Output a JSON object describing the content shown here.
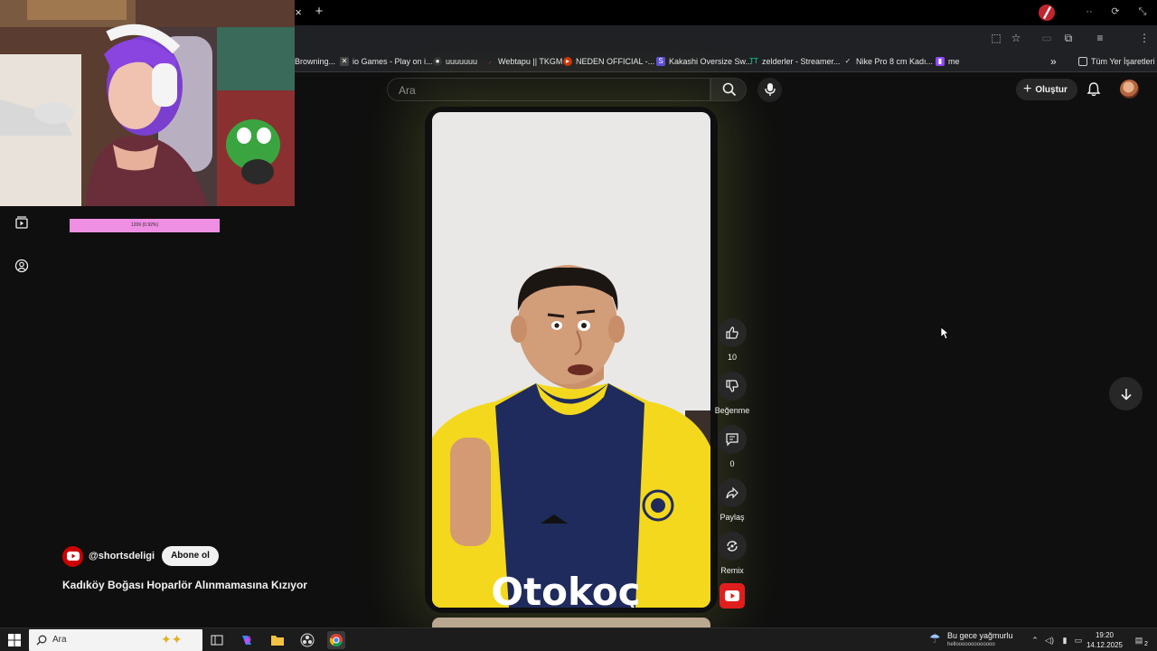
{
  "browser": {
    "tab_close": "×",
    "tab_new": "+",
    "bookmarks": [
      {
        "label": "Browning...",
        "icon": "globe-icon",
        "color": "#5f6368"
      },
      {
        "label": "io Games - Play on i...",
        "icon": "io-games-icon",
        "color": "#444444"
      },
      {
        "label": "uuuuuuu",
        "icon": "github-icon",
        "color": "#333333"
      },
      {
        "label": "Webtapu || TKGM",
        "icon": "webtapu-icon",
        "color": "#b03030"
      },
      {
        "label": "NEDEN OFFICIAL -...",
        "icon": "youtube-icon",
        "color": "#cc3300"
      },
      {
        "label": "Kakashi Oversize Sw...",
        "icon": "s-icon",
        "color": "#5b4bd6"
      },
      {
        "label": "zelderler - Streamer...",
        "icon": "tt-icon",
        "color": "#15a67a"
      },
      {
        "label": "Nike Pro 8 cm Kadı...",
        "icon": "nike-icon",
        "color": "#202124"
      },
      {
        "label": "me",
        "icon": "twitch-icon",
        "color": "#9146ff"
      }
    ],
    "bookmarks_overflow": "»",
    "all_bookmarks": "Tüm Yer İşaretleri",
    "profile_letter": "Z"
  },
  "overlay": {
    "progress_text": "1206 (0.92%)"
  },
  "youtube": {
    "search_placeholder": "Ara",
    "create_label": "Oluştur",
    "channel_handle": "@shortsdeligi",
    "subscribe_label": "Abone ol",
    "video_title": "Kadıköy Boğası Hoparlör Alınmamasına Kızıyor",
    "jersey_text": "Otokoç",
    "actions": {
      "like_count": "10",
      "dislike_label": "Beğenme",
      "comment_count": "0",
      "share_label": "Paylaş",
      "remix_label": "Remix"
    },
    "brand_color": "#ff0000"
  },
  "taskbar": {
    "search_placeholder": "Ara",
    "weather": "Bu gece yağmurlu",
    "ticker": "hellooooooooooooo",
    "time": "19:20",
    "date": "14.12.2025",
    "notification_count": "2"
  }
}
